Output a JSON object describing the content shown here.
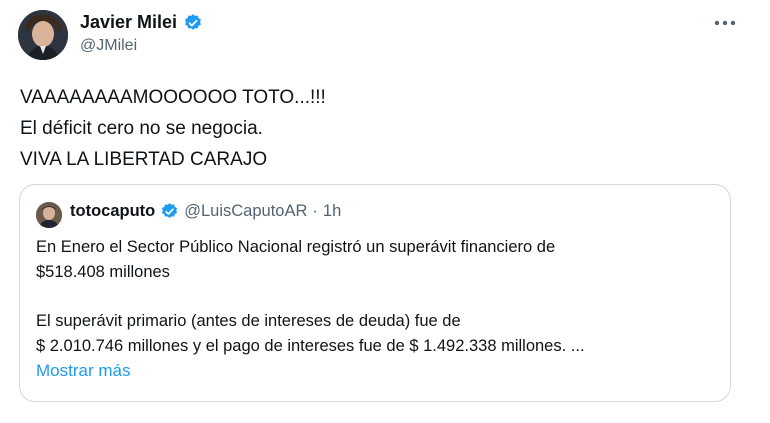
{
  "author": {
    "display_name": "Javier Milei",
    "handle": "@JMilei",
    "verified_color": "#1d9bf0"
  },
  "menu": {
    "icon": "more-horizontal-icon"
  },
  "tweet": {
    "lines": [
      "VAAAAAAAAMOOOOOO TOTO...!!!",
      "El déficit cero no se negocia.",
      "VIVA LA LIBERTAD CARAJO"
    ]
  },
  "quoted_tweet": {
    "display_name": "totocaputo",
    "handle": "@LuisCaputoAR",
    "separator": "·",
    "time": "1h",
    "paragraph1": [
      "En Enero el Sector Público Nacional registró un superávit financiero de",
      "$518.408 millones"
    ],
    "paragraph2": [
      "El superávit primario (antes de intereses de deuda) fue de",
      "$ 2.010.746 millones y el pago de intereses fue de $ 1.492.338 millones.  ..."
    ],
    "show_more_label": "Mostrar más"
  },
  "colors": {
    "text": "#0f1419",
    "secondary": "#536471",
    "link": "#1d9bf0",
    "border": "#cfd9de"
  }
}
